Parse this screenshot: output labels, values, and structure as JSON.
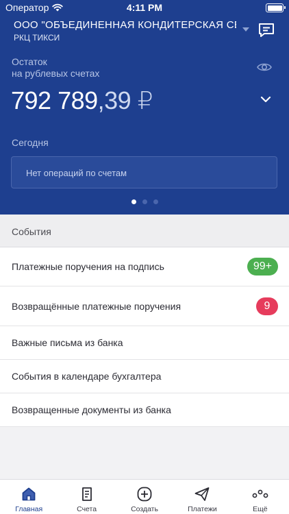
{
  "status_bar": {
    "carrier": "Оператор",
    "time": "4:11 PM"
  },
  "org": {
    "name": "ООО \"ОБЪЕДИНЕННАЯ КОНДИТЕРСКАЯ СЕ",
    "bank": "РКЦ ТИКСИ"
  },
  "balance": {
    "label_line1": "Остаток",
    "label_line2": "на рублевых счетах",
    "amount_whole": "792 789",
    "amount_fraction": ",39 ₽"
  },
  "today": {
    "label": "Сегодня",
    "empty_text": "Нет операций по счетам"
  },
  "pager": {
    "count": 3,
    "active": 1
  },
  "events": {
    "title": "События",
    "items": [
      {
        "label": "Платежные поручения на подпись",
        "badge": "99+",
        "badge_color": "#4caf50"
      },
      {
        "label": "Возвращённые платежные поручения",
        "badge": "9",
        "badge_color": "#e63c5c"
      },
      {
        "label": "Важные письма из банка"
      },
      {
        "label": "События в календаре бухгалтера"
      },
      {
        "label": "Возвращенные документы из банка"
      }
    ]
  },
  "tabs": [
    {
      "label": "Главная",
      "icon": "home-icon",
      "active": true
    },
    {
      "label": "Счета",
      "icon": "document-icon"
    },
    {
      "label": "Создать",
      "icon": "plus-circle-icon"
    },
    {
      "label": "Платежи",
      "icon": "paper-plane-icon"
    },
    {
      "label": "Ещё",
      "icon": "more-dots-icon"
    }
  ],
  "colors": {
    "hero_bg": "#1e3f8f",
    "accent": "#1e3f8f",
    "badge_green": "#4caf50",
    "badge_red": "#e63c5c"
  }
}
